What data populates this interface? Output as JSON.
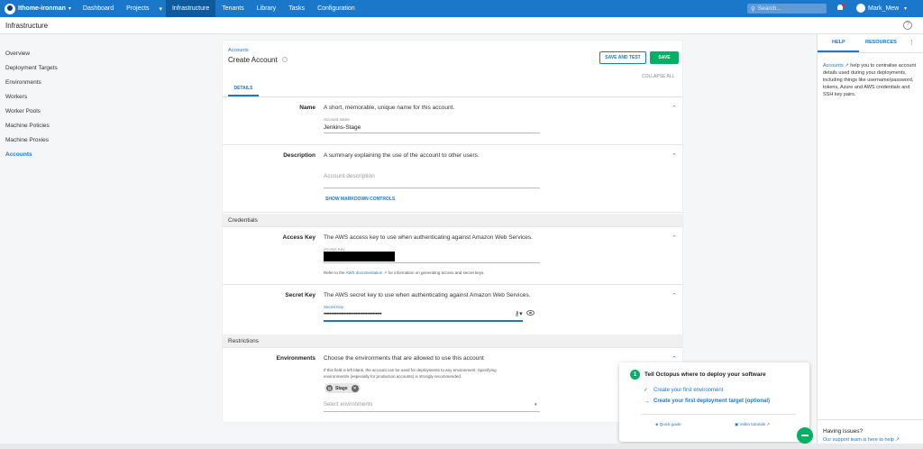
{
  "topbar": {
    "space": "Ithome-ironman",
    "nav": [
      "Dashboard",
      "Projects",
      "Infrastructure",
      "Tenants",
      "Library",
      "Tasks",
      "Configuration"
    ],
    "search_placeholder": "Search...",
    "user": "Mark_Mew"
  },
  "page_title": "Infrastructure",
  "sidebar": {
    "items": [
      "Overview",
      "Deployment Targets",
      "Environments",
      "Workers",
      "Worker Pools",
      "Machine Policies",
      "Machine Proxies",
      "Accounts"
    ],
    "active": "Accounts"
  },
  "form": {
    "breadcrumb": "Accounts",
    "title": "Create Account",
    "save_and_test": "SAVE AND TEST",
    "save": "SAVE",
    "collapse_all": "COLLAPSE ALL",
    "tab": "DETAILS",
    "name": {
      "label": "Name",
      "desc": "A short, memorable, unique name for this account.",
      "field_label": "Account name",
      "value": "Jenkins-Stage"
    },
    "description": {
      "label": "Description",
      "desc": "A summary explaining the use of the account to other users.",
      "placeholder": "Account description",
      "markdown_link": "SHOW MARKDOWN CONTROLS"
    },
    "credentials_title": "Credentials",
    "access_key": {
      "label": "Access Key",
      "desc": "The AWS access key to use when authenticating against Amazon Web Services.",
      "field_label": "Access Key",
      "help_pre": "Refer to the",
      "help_link": "AWS documentation",
      "help_post": "for information on generating access and secret keys."
    },
    "secret_key": {
      "label": "Secret Key",
      "desc": "The AWS secret key to use when authenticating against Amazon Web Services.",
      "field_label": "Secret Key",
      "value": "••••••••••••••••••••••••••••••••••••••••"
    },
    "restrictions_title": "Restrictions",
    "environments": {
      "label": "Environments",
      "desc": "Choose the environments that are allowed to use this account",
      "help_line1": "If this field is left blank, the account can be used for deployments to any environment. Specifying",
      "help_line2": "environment/s (especially for production accounts) is strongly recommended.",
      "chip": "Stage",
      "placeholder": "Select environments"
    }
  },
  "help_panel": {
    "tab_help": "HELP",
    "tab_resources": "RESOURCES",
    "text_link": "Accounts",
    "text": "help you to centralise account details used during your deployments, including things like username/password, tokens, Azure and AWS credentials and SSH key pairs.",
    "issues_title": "Having issues?",
    "issues_link": "Our support team is here to help"
  },
  "onboarding": {
    "step": "1",
    "title": "Tell Octopus where to deploy your software",
    "item1": "Create your first environment",
    "item2": "Create your first deployment target (optional)",
    "quick_guide": "Quick guide",
    "video_tutorials": "Video tutorials"
  },
  "colors": {
    "brand": "#1a77ca",
    "save": "#00b065"
  }
}
